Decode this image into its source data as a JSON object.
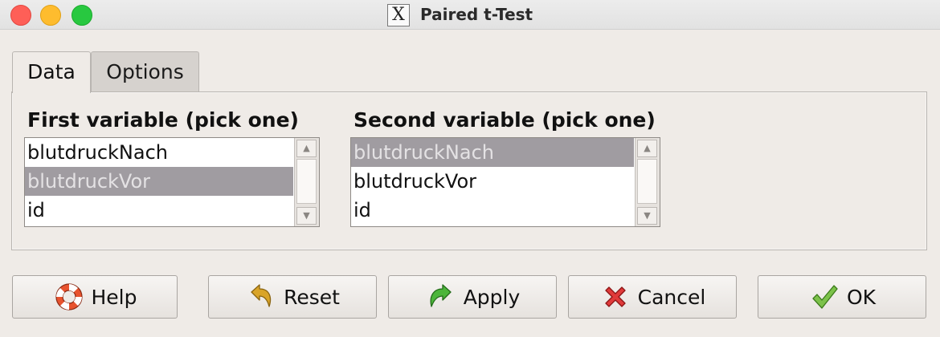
{
  "window": {
    "title": "Paired t-Test",
    "app_icon_glyph": "X"
  },
  "tabs": [
    {
      "label": "Data",
      "active": true
    },
    {
      "label": "Options",
      "active": false
    }
  ],
  "first_variable": {
    "label": "First variable (pick one)",
    "items": [
      "blutdruckNach",
      "blutdruckVor",
      "id"
    ],
    "selected": "blutdruckVor"
  },
  "second_variable": {
    "label": "Second variable (pick one)",
    "items": [
      "blutdruckNach",
      "blutdruckVor",
      "id"
    ],
    "selected": "blutdruckNach"
  },
  "buttons": {
    "help": "Help",
    "reset": "Reset",
    "apply": "Apply",
    "cancel": "Cancel",
    "ok": "OK"
  },
  "icons": {
    "help": "lifebuoy-icon",
    "reset": "undo-arrow-icon",
    "apply": "green-arrow-icon",
    "cancel": "red-x-icon",
    "ok": "green-check-icon"
  },
  "colors": {
    "selection": "#a09ca1",
    "background": "#efebe7"
  }
}
